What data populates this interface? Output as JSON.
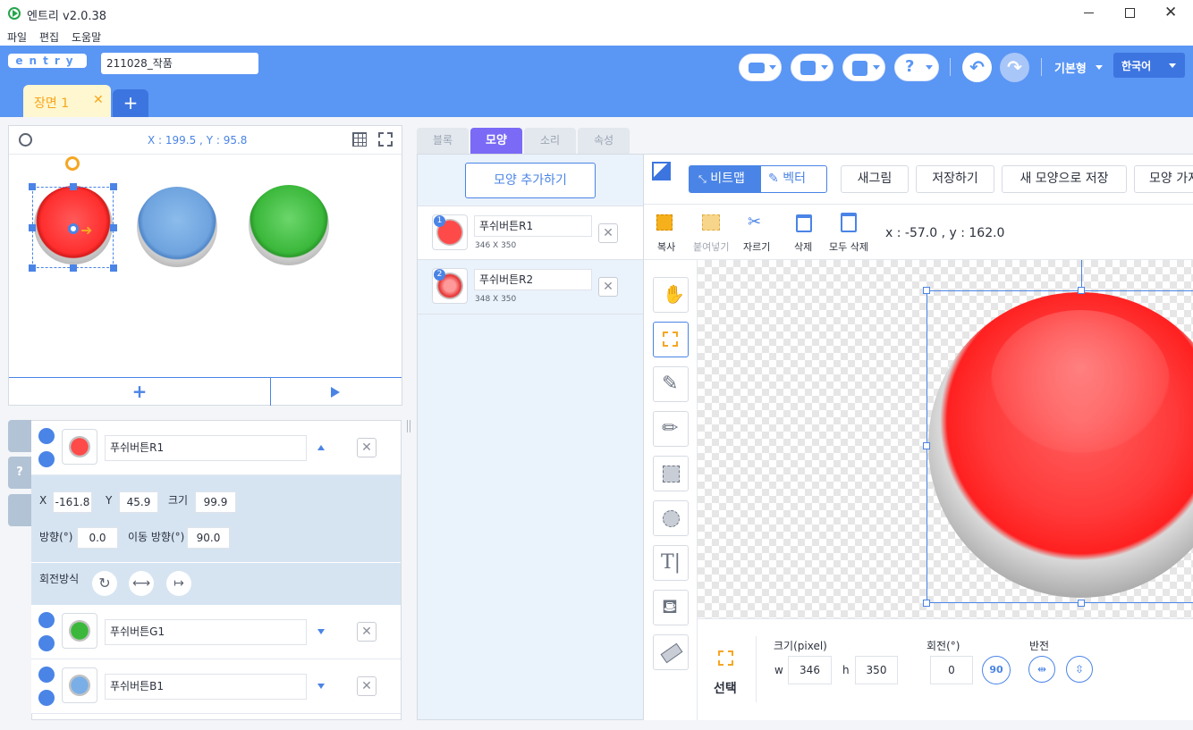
{
  "window": {
    "title": "엔트리 v2.0.38"
  },
  "menu": [
    "파일",
    "편집",
    "도움말"
  ],
  "header": {
    "logo": "entry",
    "project_name": "211028_작품",
    "mode": "기본형",
    "language": "한국어"
  },
  "scene": {
    "tab": "장면 1",
    "close": "✕",
    "add": "+"
  },
  "stage": {
    "coords": "X : 199.5 , Y : 95.8"
  },
  "sprite_tabs": {
    "block": "블록",
    "shape": "모양",
    "sound": "소리",
    "props": "속성"
  },
  "shapes": {
    "add_button": "모양 추가하기",
    "items": [
      {
        "index": "1",
        "name": "푸쉬버튼R1",
        "size": "346 X 350"
      },
      {
        "index": "2",
        "name": "푸쉬버튼R2",
        "size": "348 X 350"
      }
    ]
  },
  "editor": {
    "bitmap": "비트맵",
    "vector": "벡터",
    "new_drawing": "새그림",
    "save": "저장하기",
    "save_new": "새 모양으로 저장",
    "import": "모양 가져",
    "copy": "복사",
    "paste": "붙여넣기",
    "cut": "자르기",
    "delete": "삭제",
    "delete_all": "모두 삭제",
    "coords": "x : -57.0 , y : 162.0",
    "select_label": "선택",
    "size_label": "크기(pixel)",
    "w_label": "w",
    "w": "346",
    "h_label": "h",
    "h": "350",
    "rotation_label": "회전(°)",
    "rotation": "0",
    "rot90": "90",
    "flip_label": "반전"
  },
  "objects": {
    "selected": {
      "name": "푸쉬버튼R1",
      "x_label": "X",
      "x": "-161.8",
      "y_label": "Y",
      "y": "45.9",
      "size_label": "크기",
      "size": "99.9",
      "dir_label": "방향(°)",
      "dir": "0.0",
      "move_dir_label": "이동 방향(°)",
      "move_dir": "90.0",
      "rotation_label": "회전방식"
    },
    "others": [
      {
        "name": "푸쉬버튼G1",
        "color": "#3bb83b"
      },
      {
        "name": "푸쉬버튼B1",
        "color": "#7aaee6"
      }
    ]
  },
  "colors": {
    "header": "#5a96f4",
    "accent": "#4a84e6",
    "tab_active": "#7a6af5",
    "scene_tab": "#fff7cf"
  }
}
